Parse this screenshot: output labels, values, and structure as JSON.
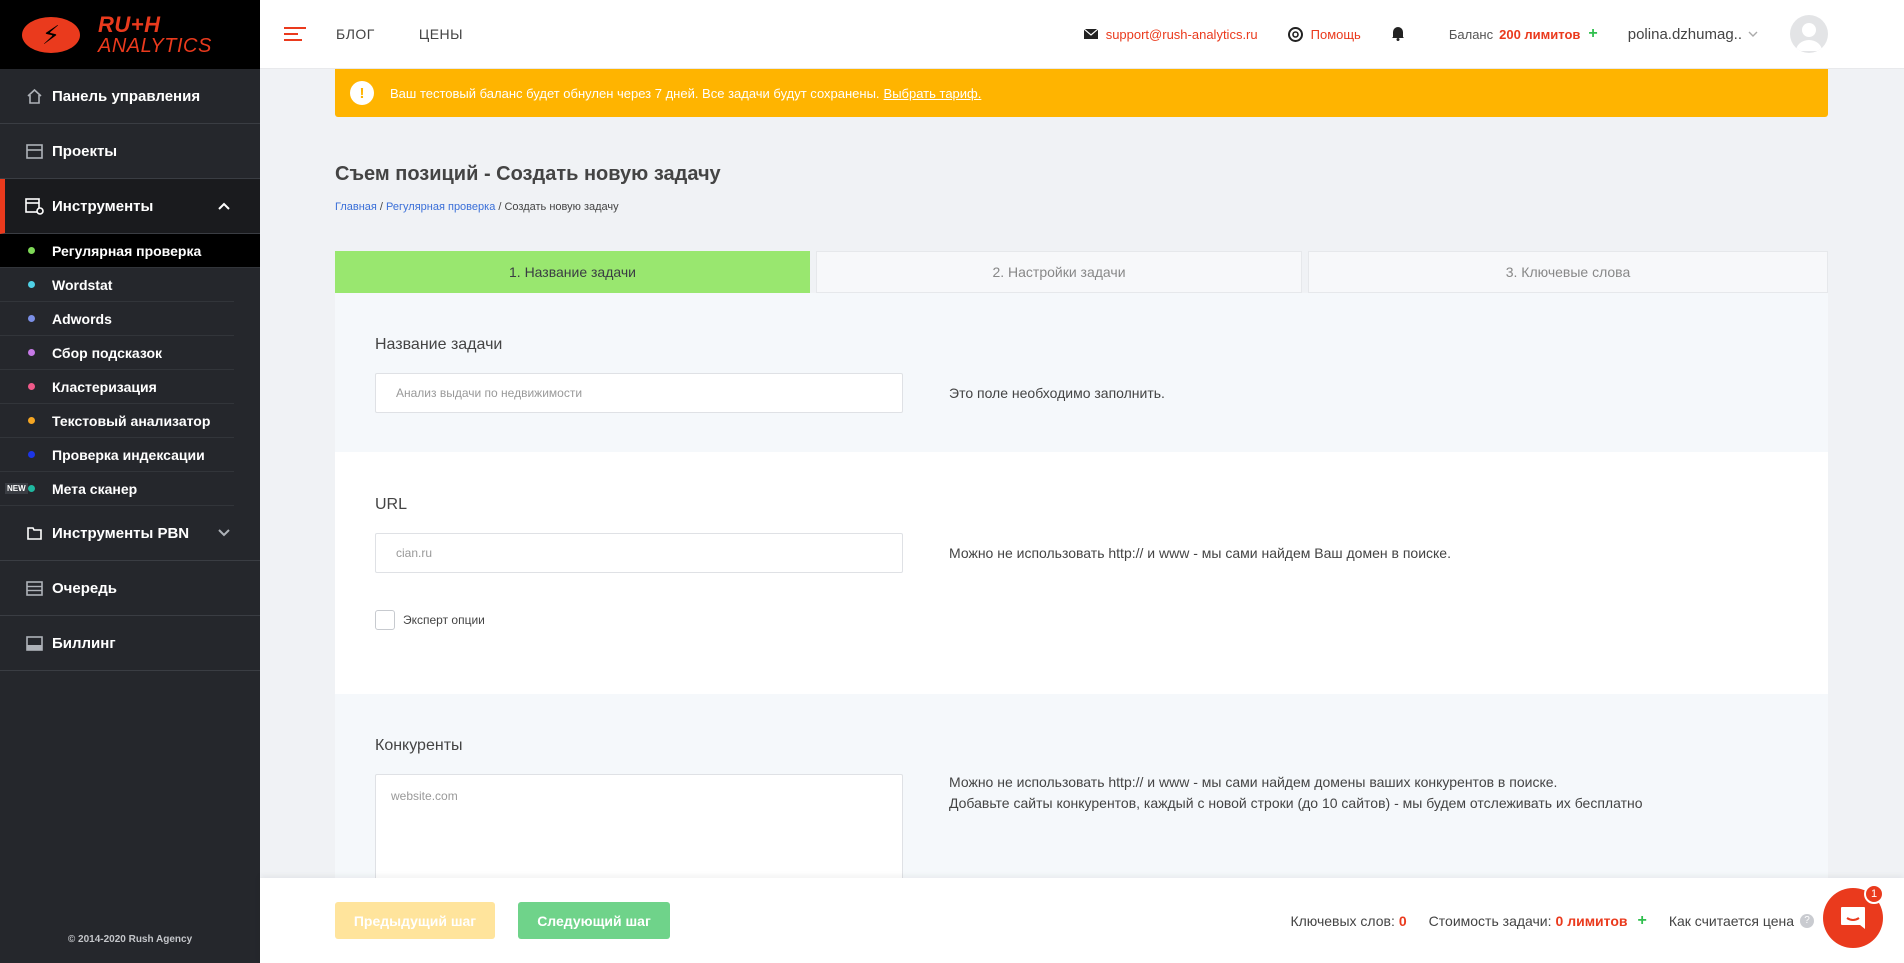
{
  "brand": {
    "line1": "RU+H",
    "line2": "ANALYTICS",
    "mark": "⚡"
  },
  "sidebar": {
    "items": [
      {
        "label": "Панель управления",
        "icon": "home-icon"
      },
      {
        "label": "Проекты",
        "icon": "projects-icon"
      },
      {
        "label": "Инструменты",
        "icon": "tools-icon",
        "active": true
      },
      {
        "label": "Инструменты PBN",
        "icon": "folder-icon"
      },
      {
        "label": "Очередь",
        "icon": "queue-icon"
      },
      {
        "label": "Биллинг",
        "icon": "billing-icon"
      }
    ],
    "tools": [
      {
        "label": "Регулярная проверка",
        "color": "#7ed957"
      },
      {
        "label": "Wordstat",
        "color": "#4fd1e6"
      },
      {
        "label": "Adwords",
        "color": "#7b8fe6"
      },
      {
        "label": "Сбор подсказок",
        "color": "#c679e6"
      },
      {
        "label": "Кластеризация",
        "color": "#f05a8a"
      },
      {
        "label": "Текстовый анализатор",
        "color": "#f5a623"
      },
      {
        "label": "Проверка индексации",
        "color": "#1c35e6"
      },
      {
        "label": "Мета сканер",
        "color": "#1fb8a0"
      }
    ],
    "new_badge": "NEW",
    "copyright": "© 2014-2020 Rush Agency"
  },
  "header": {
    "links": [
      "БЛОГ",
      "ЦЕНЫ"
    ],
    "support_email": "support@rush-analytics.ru",
    "help": "Помощь",
    "balance_label": "Баланс",
    "balance_value": "200 лимитов",
    "plus": "+",
    "username": "polina.dzhumag.."
  },
  "warning": {
    "icon": "!",
    "text": "Ваш тестовый баланс будет обнулен через 7 дней. Все задачи будут сохранены.",
    "link": "Выбрать тариф."
  },
  "page": {
    "title": "Съем позиций - Создать новую задачу",
    "breadcrumb": {
      "home": "Главная",
      "section": "Регулярная проверка",
      "sep": " / ",
      "current": "Создать новую задачу"
    }
  },
  "steps": [
    "1. Название задачи",
    "2. Настройки задачи",
    "3. Ключевые слова"
  ],
  "form": {
    "name": {
      "label": "Название задачи",
      "placeholder": "Анализ выдачи по недвижимости",
      "hint": "Это поле необходимо заполнить."
    },
    "url": {
      "label": "URL",
      "placeholder": "cian.ru",
      "hint": "Можно не использовать http:// и www - мы сами найдем Ваш домен в поиске.",
      "expert": "Эксперт опции"
    },
    "competitors": {
      "label": "Конкуренты",
      "placeholder": "website.com",
      "hint1": "Можно не использовать http:// и www - мы сами найдем домены ваших конкурентов в поиске.",
      "hint2": "Добавьте сайты конкурентов, каждый с новой строки (до 10 сайтов) - мы будем отслеживать их бесплатно"
    }
  },
  "footer": {
    "prev": "Предыдущий шаг",
    "next": "Следующий шаг",
    "keywords_label": "Ключевых слов:",
    "keywords_value": "0",
    "cost_label": "Стоимость задачи:",
    "cost_value": "0 лимитов",
    "plus": "+",
    "how_label": "Как считается цена",
    "qmark": "?",
    "chat_badge": "1"
  }
}
